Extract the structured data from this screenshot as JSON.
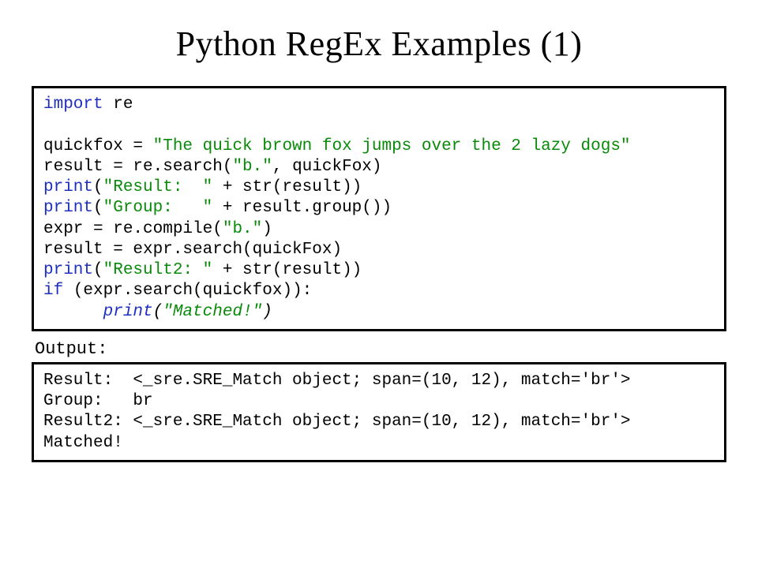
{
  "title": "Python RegEx Examples (1)",
  "code": {
    "l1_a": "import",
    "l1_b": " re",
    "blank": " ",
    "l2_a": "quickfox = ",
    "l2_b": "\"The quick brown fox jumps over the 2 lazy dogs\"",
    "l3_a": "result = re.search(",
    "l3_b": "\"b.\"",
    "l3_c": ", quickFox)",
    "l4_a": "print",
    "l4_b": "(",
    "l4_c": "\"Result:  \"",
    "l4_d": " + str(result))",
    "l5_a": "print",
    "l5_b": "(",
    "l5_c": "\"Group:   \"",
    "l5_d": " + result.group())",
    "l6_a": "expr = re.compile(",
    "l6_b": "\"b.\"",
    "l6_c": ")",
    "l7": "result = expr.search(quickFox)",
    "l8_a": "print",
    "l8_b": "(",
    "l8_c": "\"Result2: \"",
    "l8_d": " + str(result))",
    "l9_a": "if",
    "l9_b": " (expr.search(quickfox)):",
    "l10_a": "      ",
    "l10_b": "print",
    "l10_c": "(",
    "l10_d": "\"Matched!\"",
    "l10_e": ")"
  },
  "output_label": "Output:",
  "output": {
    "o1": "Result:  <_sre.SRE_Match object; span=(10, 12), match='br'>",
    "o2": "Group:   br",
    "o3": "Result2: <_sre.SRE_Match object; span=(10, 12), match='br'>",
    "o4": "Matched!"
  }
}
